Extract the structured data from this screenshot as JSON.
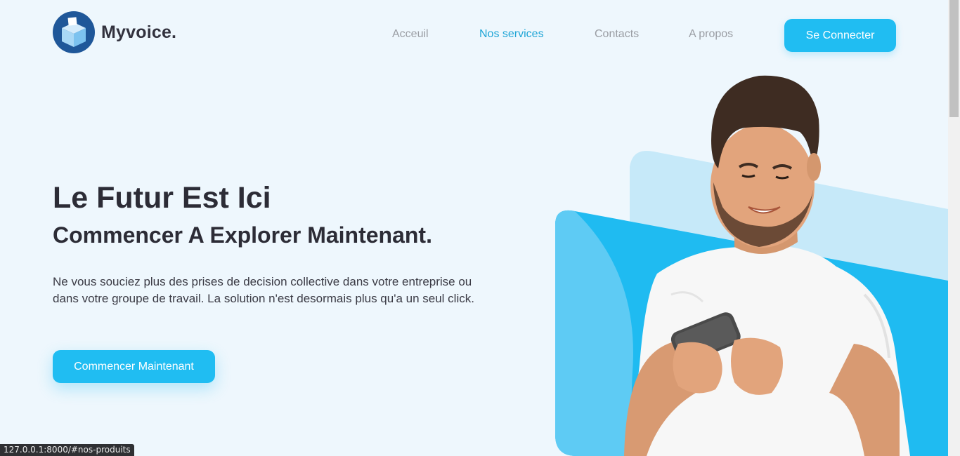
{
  "header": {
    "brand": "Myvoice.",
    "logo_icon": "ballot-box-icon",
    "nav": [
      {
        "label": "Acceuil",
        "active": false
      },
      {
        "label": "Nos services",
        "active": true
      },
      {
        "label": "Contacts",
        "active": false
      },
      {
        "label": "A propos",
        "active": false
      }
    ],
    "connect_label": "Se Connecter"
  },
  "hero": {
    "title": "Le Futur Est Ici",
    "subtitle": "Commencer A Explorer Maintenant.",
    "description": "Ne vous souciez plus des prises de decision collective dans votre entreprise ou dans votre groupe de travail. La solution n'est desormais plus qu'a un seul click.",
    "cta_label": "Commencer Maintenant",
    "image": "smiling-man-with-phone"
  },
  "status_bar": {
    "url": "127.0.0.1:8000/#nos-produits"
  },
  "colors": {
    "accent": "#20bdf2",
    "nav_active": "#1fa5d6",
    "background": "#eef7fd"
  }
}
